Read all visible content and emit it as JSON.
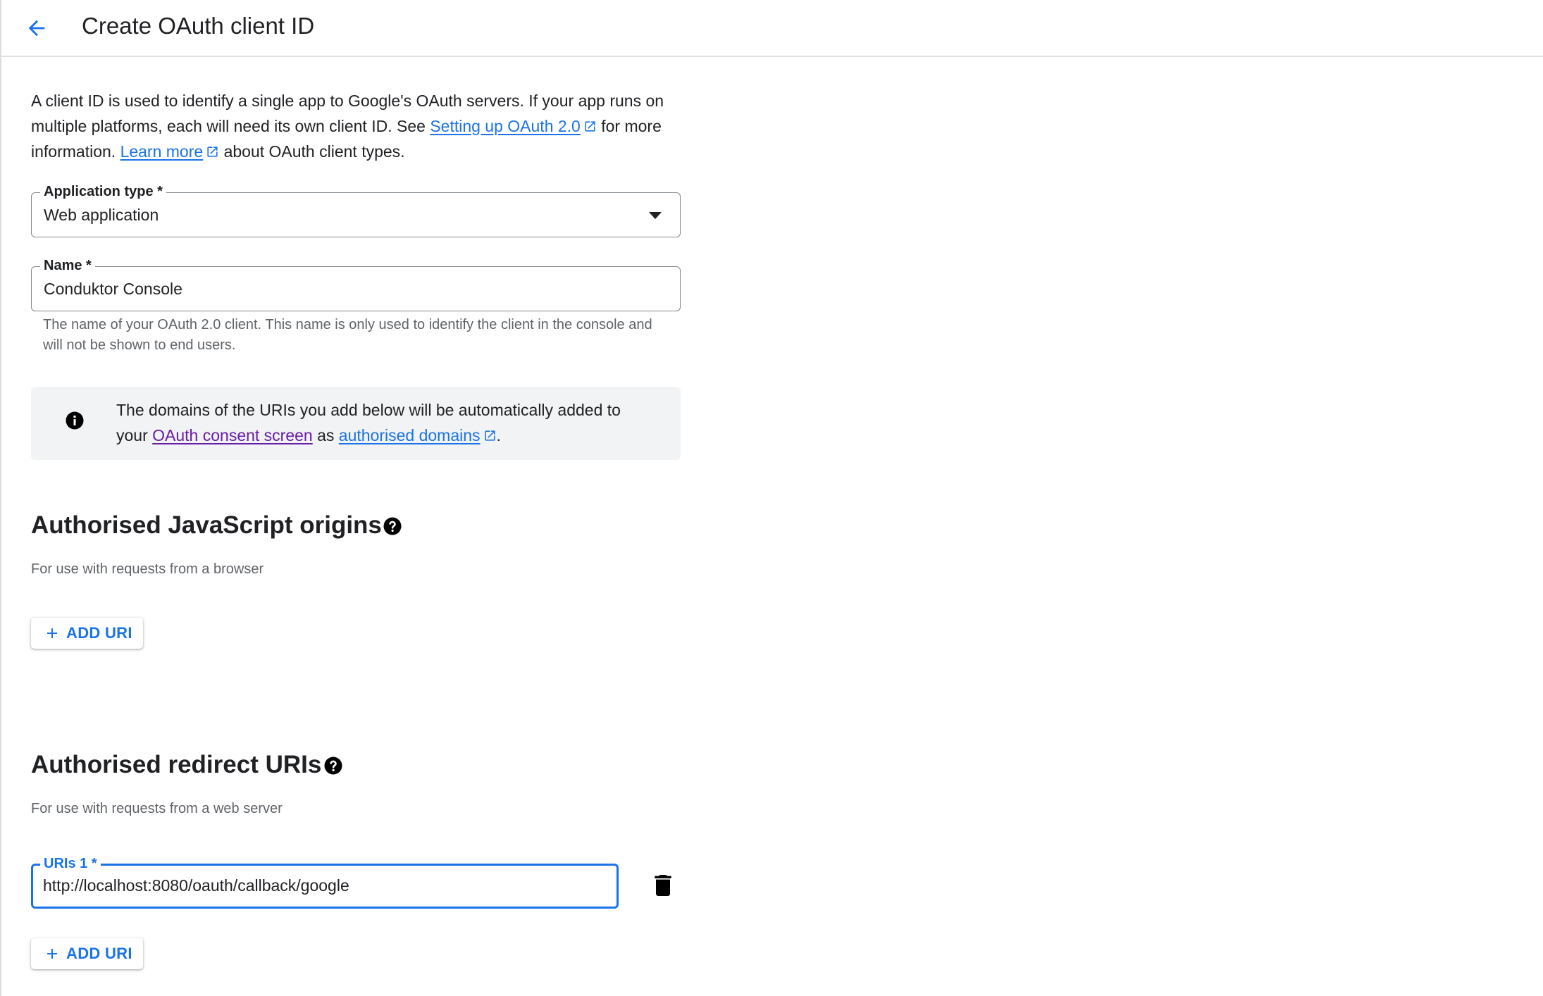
{
  "header": {
    "title": "Create OAuth client ID"
  },
  "intro": {
    "text_1": "A client ID is used to identify a single app to Google's OAuth servers. If your app runs on multiple platforms, each will need its own client ID. See ",
    "link_setup": "Setting up OAuth 2.0",
    "text_2": " for more information. ",
    "link_learn": "Learn more",
    "text_3": " about OAuth client types."
  },
  "application_type": {
    "label": "Application type *",
    "value": "Web application"
  },
  "name_field": {
    "label": "Name *",
    "value": "Conduktor Console",
    "hint": "The name of your OAuth 2.0 client. This name is only used to identify the client in the console and will not be shown to end users."
  },
  "info": {
    "text_1": "The domains of the URIs you add below will be automatically added to your ",
    "link_consent": "OAuth consent screen",
    "text_2": " as ",
    "link_domains": "authorised domains",
    "text_3": "."
  },
  "js_origins": {
    "title": "Authorised JavaScript origins",
    "subtitle": "For use with requests from a browser",
    "add_label": "ADD URI"
  },
  "redirect_uris": {
    "title": "Authorised redirect URIs",
    "subtitle": "For use with requests from a web server",
    "uri_label": "URIs 1 *",
    "uri_value": "http://localhost:8080/oauth/callback/google",
    "add_label": "ADD URI"
  },
  "colors": {
    "accent": "#1a73e8",
    "visited_link": "#681da8",
    "text": "#202124",
    "muted": "#5f6368"
  },
  "icons": [
    "arrow-back-icon",
    "external-link-icon",
    "dropdown-arrow-icon",
    "info-icon",
    "help-icon",
    "plus-icon",
    "trash-icon"
  ]
}
